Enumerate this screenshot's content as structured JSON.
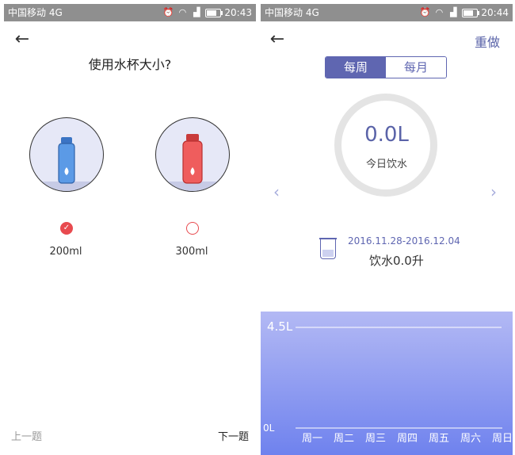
{
  "left_screen": {
    "statusbar": {
      "carrier": "中国移动 4G",
      "time": "20:43"
    },
    "question": "使用水杯大小?",
    "options": [
      {
        "label": "200ml",
        "selected": true,
        "bottle_color": "#4f8fdc"
      },
      {
        "label": "300ml",
        "selected": false,
        "bottle_color": "#e74c4c"
      }
    ],
    "prev_label": "上一题",
    "next_label": "下一题"
  },
  "right_screen": {
    "statusbar": {
      "carrier": "中国移动 4G",
      "time": "20:44"
    },
    "redo_label": "重做",
    "tabs": [
      {
        "label": "每周",
        "active": true
      },
      {
        "label": "每月",
        "active": false
      }
    ],
    "today_value": "0.0L",
    "today_label": "今日饮水",
    "date_range": "2016.11.28-2016.12.04",
    "total_label": "饮水0.0升"
  },
  "colors": {
    "accent": "#5f66b1",
    "red": "#e84a4f",
    "chart_top": "#b3b9f4",
    "chart_bottom": "#6f82ee"
  },
  "chart_data": {
    "type": "area",
    "categories": [
      "周一",
      "周二",
      "周三",
      "周四",
      "周五",
      "周六",
      "周日"
    ],
    "values": [
      0,
      0,
      0,
      0,
      0,
      0,
      0
    ],
    "ylim": [
      0,
      4.5
    ],
    "y_tick_labels": [
      "4.5L",
      "0L"
    ],
    "grid": true
  }
}
